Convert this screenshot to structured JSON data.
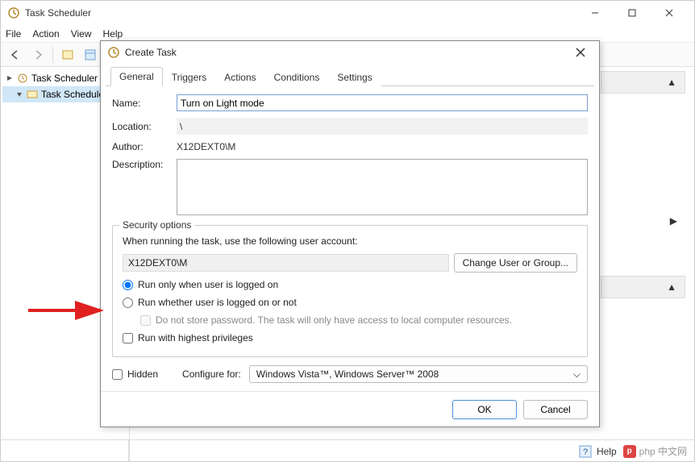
{
  "window": {
    "title": "Task Scheduler",
    "menus": [
      "File",
      "Action",
      "View",
      "Help"
    ]
  },
  "tree": {
    "root": "Task Scheduler (L",
    "child": "Task Schedule"
  },
  "dialog": {
    "title": "Create Task",
    "tabs": [
      "General",
      "Triggers",
      "Actions",
      "Conditions",
      "Settings"
    ],
    "labels": {
      "name": "Name:",
      "location": "Location:",
      "author": "Author:",
      "description": "Description:"
    },
    "values": {
      "name": "Turn on Light mode",
      "location": "\\",
      "author": "X12DEXT0\\M"
    },
    "security": {
      "legend": "Security options",
      "prompt": "When running the task, use the following user account:",
      "account": "X12DEXT0\\M",
      "change_btn": "Change User or Group...",
      "radio1": "Run only when user is logged on",
      "radio2": "Run whether user is logged on or not",
      "nostorepw": "Do not store password.  The task will only have access to local computer resources.",
      "highest": "Run with highest privileges"
    },
    "hidden_label": "Hidden",
    "configure_label": "Configure for:",
    "configure_value": "Windows Vista™, Windows Server™ 2008",
    "ok": "OK",
    "cancel": "Cancel"
  },
  "statusbar": {
    "help": "Help",
    "brand": "php 中文网"
  }
}
